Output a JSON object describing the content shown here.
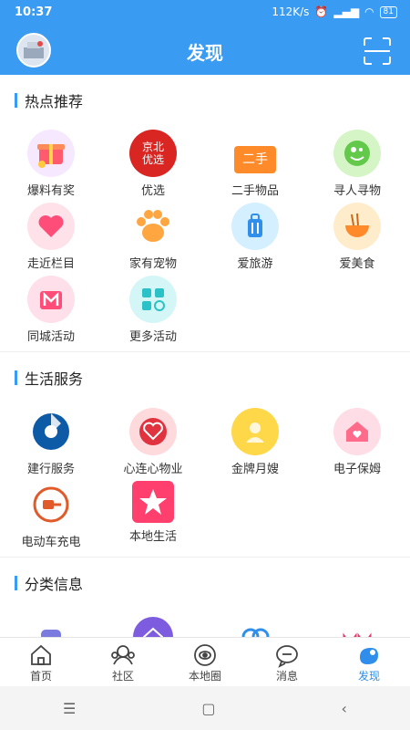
{
  "status": {
    "time": "10:37",
    "speed": "112K/s",
    "battery": "81"
  },
  "header": {
    "title": "发现"
  },
  "sections": [
    {
      "title": "热点推荐",
      "items": [
        "爆料有奖",
        "优选",
        "二手物品",
        "寻人寻物",
        "走近栏目",
        "家有宠物",
        "爱旅游",
        "爱美食",
        "同城活动",
        "更多活动"
      ]
    },
    {
      "title": "生活服务",
      "items": [
        "建行服务",
        "心连心物业",
        "金牌月嫂",
        "电子保姆",
        "电动车充电",
        "本地生活"
      ]
    },
    {
      "title": "分类信息",
      "items": []
    }
  ],
  "icon_text": {
    "youxuan": "京北\n优选",
    "ershou": "二手"
  },
  "tabs": [
    {
      "label": "首页",
      "icon": "home-icon"
    },
    {
      "label": "社区",
      "icon": "community-icon"
    },
    {
      "label": "本地圈",
      "icon": "local-circle-icon"
    },
    {
      "label": "消息",
      "icon": "message-icon"
    },
    {
      "label": "发现",
      "icon": "discover-icon",
      "active": true
    }
  ],
  "colors": {
    "accent": "#3A9BF2"
  }
}
